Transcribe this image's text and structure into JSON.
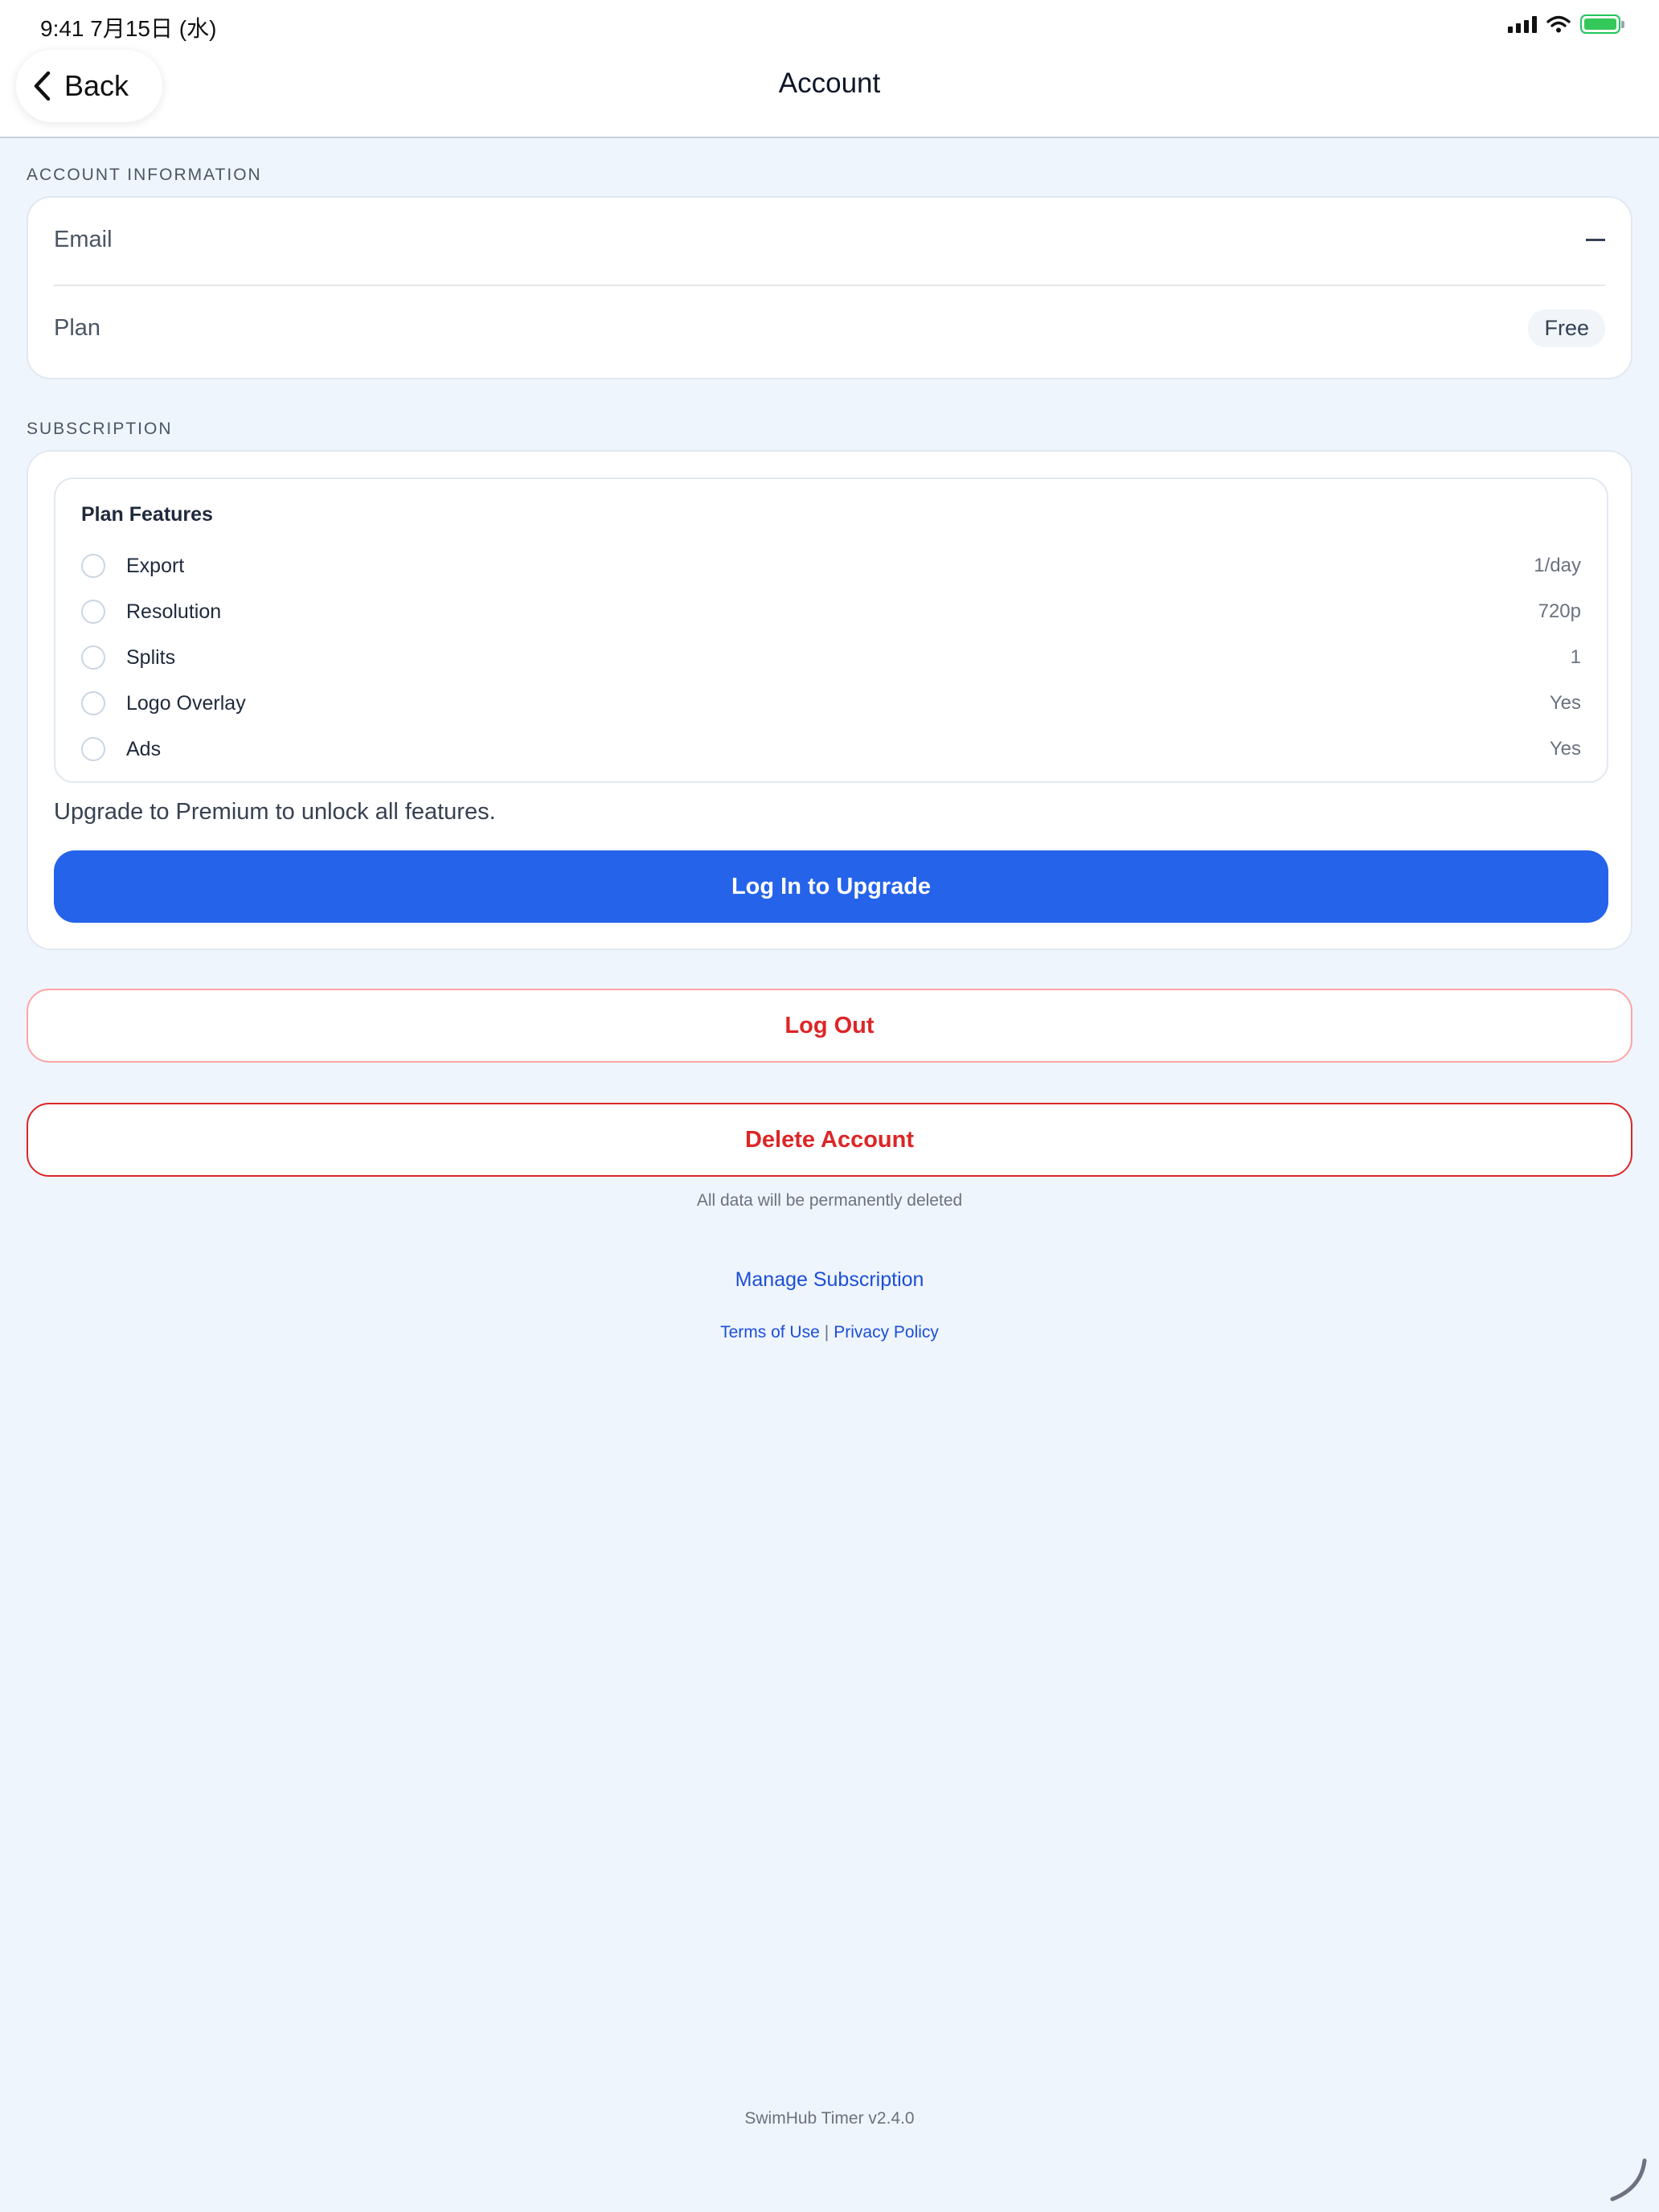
{
  "status_bar": {
    "time_date": "9:41   7月15日 (水)"
  },
  "nav": {
    "back_label": "Back",
    "title": "Account"
  },
  "account_information": {
    "section_label": "ACCOUNT INFORMATION",
    "email_label": "Email",
    "plan_label": "Plan",
    "plan_value": "Free"
  },
  "subscription": {
    "section_label": "SUBSCRIPTION",
    "features_title": "Plan Features",
    "features": [
      {
        "label": "Export",
        "value": "1/day"
      },
      {
        "label": "Resolution",
        "value": "720p"
      },
      {
        "label": "Splits",
        "value": "1"
      },
      {
        "label": "Logo Overlay",
        "value": "Yes"
      },
      {
        "label": "Ads",
        "value": "Yes"
      }
    ],
    "upgrade_text": "Upgrade to Premium to unlock all features.",
    "upgrade_button": "Log In to Upgrade"
  },
  "actions": {
    "logout": "Log Out",
    "delete": "Delete Account",
    "delete_note": "All data will be permanently deleted",
    "manage_subscription": "Manage Subscription",
    "terms": "Terms of Use",
    "separator": "|",
    "privacy": "Privacy Policy"
  },
  "footer": {
    "version": "SwimHub Timer v2.4.0"
  },
  "colors": {
    "primary": "#2563eb",
    "danger": "#dc2626",
    "link": "#1d4ed8",
    "background": "#eef5fd"
  }
}
